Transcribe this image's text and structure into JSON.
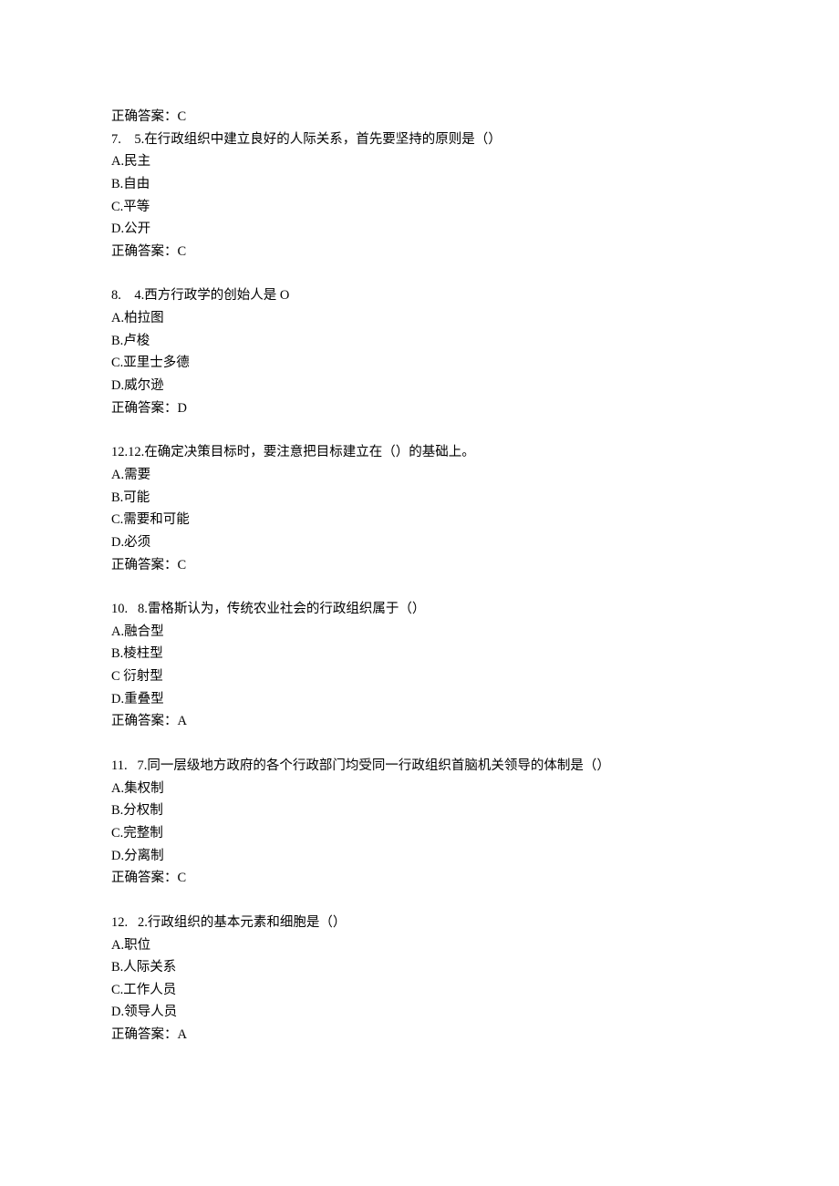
{
  "questions": [
    {
      "prefix_answer": "正确答案：C",
      "number": "7.",
      "qnum": "5.",
      "stem": "在行政组织中建立良好的人际关系，首先要坚持的原则是（）",
      "options": [
        "A.民主",
        "B.自由",
        "C.平等",
        "D.公开"
      ],
      "answer": "正确答案：C"
    },
    {
      "number": "8.",
      "qnum": "4.",
      "stem": "西方行政学的创始人是 O",
      "options": [
        "A.柏拉图",
        "B.卢梭",
        "C.亚里士多德",
        "D.威尔逊"
      ],
      "answer": "正确答案：D"
    },
    {
      "number": "12.12.",
      "qnum": "",
      "stem": "在确定决策目标时，要注意把目标建立在（）的基础上。",
      "options": [
        "A.需要",
        "B.可能",
        "C.需要和可能",
        "D.必须"
      ],
      "answer": "正确答案：C"
    },
    {
      "number": "10.",
      "qnum": "8.",
      "stem": "雷格斯认为，传统农业社会的行政组织属于（）",
      "options": [
        "A.融合型",
        "B.棱柱型",
        "C 衍射型",
        "D.重叠型"
      ],
      "answer": "正确答案：A"
    },
    {
      "number": "11.",
      "qnum": "7.",
      "stem": "同一层级地方政府的各个行政部门均受同一行政组织首脑机关领导的体制是（）",
      "options": [
        "A.集权制",
        "B.分权制",
        "C.完整制",
        "D.分离制"
      ],
      "answer": "正确答案：C"
    },
    {
      "number": "12.",
      "qnum": "2.",
      "stem": "行政组织的基本元素和细胞是（）",
      "options": [
        "A.职位",
        "B.人际关系",
        "C.工作人员",
        "D.领导人员"
      ],
      "answer": "正确答案：A"
    }
  ]
}
